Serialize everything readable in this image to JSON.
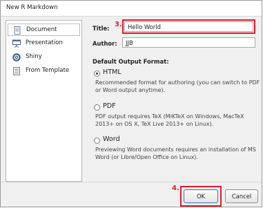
{
  "window": {
    "title": "New R Markdown"
  },
  "sidebar": {
    "items": [
      {
        "label": "Document",
        "icon": "document-icon",
        "selected": true
      },
      {
        "label": "Presentation",
        "icon": "presentation-icon",
        "selected": false
      },
      {
        "label": "Shiny",
        "icon": "shiny-icon",
        "selected": false
      },
      {
        "label": "From Template",
        "icon": "template-icon",
        "selected": false
      }
    ]
  },
  "form": {
    "title_label": "Title:",
    "title_value": "Hello World",
    "author_label": "Author:",
    "author_value": "JJB"
  },
  "output": {
    "heading": "Default Output Format:",
    "options": [
      {
        "label": "HTML",
        "checked": true,
        "desc": [
          "Recommended format for authoring (you can switch to PDF",
          "or Word output anytime)."
        ]
      },
      {
        "label": "PDF",
        "checked": false,
        "desc": [
          "PDF output requires TeX (MiKTeX on Windows, MacTeX",
          "2013+ on OS X, TeX Live 2013+ on Linux)."
        ]
      },
      {
        "label": "Word",
        "checked": false,
        "desc": [
          "Previewing Word documents requires an installation of MS",
          "Word (or Libre/Open Office on Linux)."
        ]
      }
    ]
  },
  "annotations": {
    "step3": "3.",
    "step4": "4."
  },
  "buttons": {
    "ok": "OK",
    "cancel": "Cancel"
  },
  "colors": {
    "annotation_red": "#e01b2a",
    "ok_border": "#3a6fb0"
  }
}
